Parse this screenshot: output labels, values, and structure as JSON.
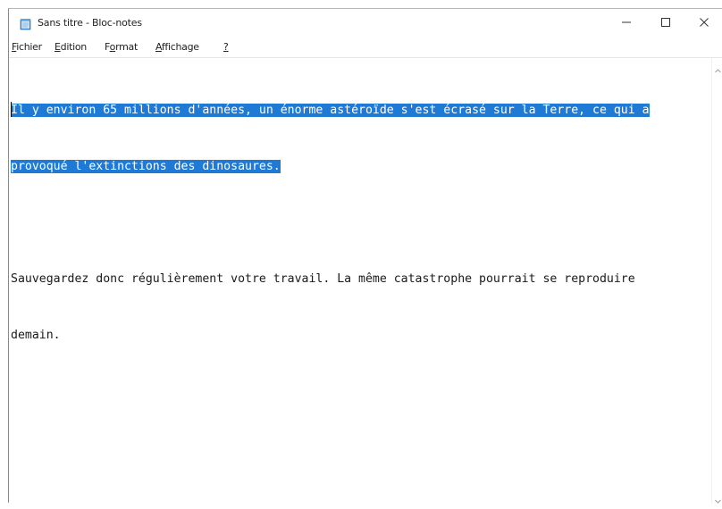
{
  "window": {
    "title": "Sans titre - Bloc-notes",
    "app_icon": "notepad-icon",
    "controls": {
      "minimize": "minimize-icon",
      "maximize": "maximize-icon",
      "close": "close-icon"
    }
  },
  "menu": {
    "fichier": {
      "first": "F",
      "rest": "ichier"
    },
    "edition": {
      "first": "E",
      "rest": "dition"
    },
    "format": {
      "pre": "F",
      "under": "o",
      "rest": "rmat"
    },
    "affichage": {
      "first": "A",
      "rest": "ffichage"
    },
    "help": "?"
  },
  "editor": {
    "line1_selected": "Il y environ 65 millions d'années, un énorme astéroïde s'est écrasé sur la Terre, ce qui a",
    "line2_selected": "provoqué l'extinctions des dinosaures.",
    "line3": "",
    "line4": "Sauvegardez donc régulièrement votre travail. La même catastrophe pourrait se reproduire",
    "line5": "demain."
  },
  "colors": {
    "selection": "#1f7ad6",
    "selection_text": "#ffffff",
    "text": "#1a1a1a"
  }
}
